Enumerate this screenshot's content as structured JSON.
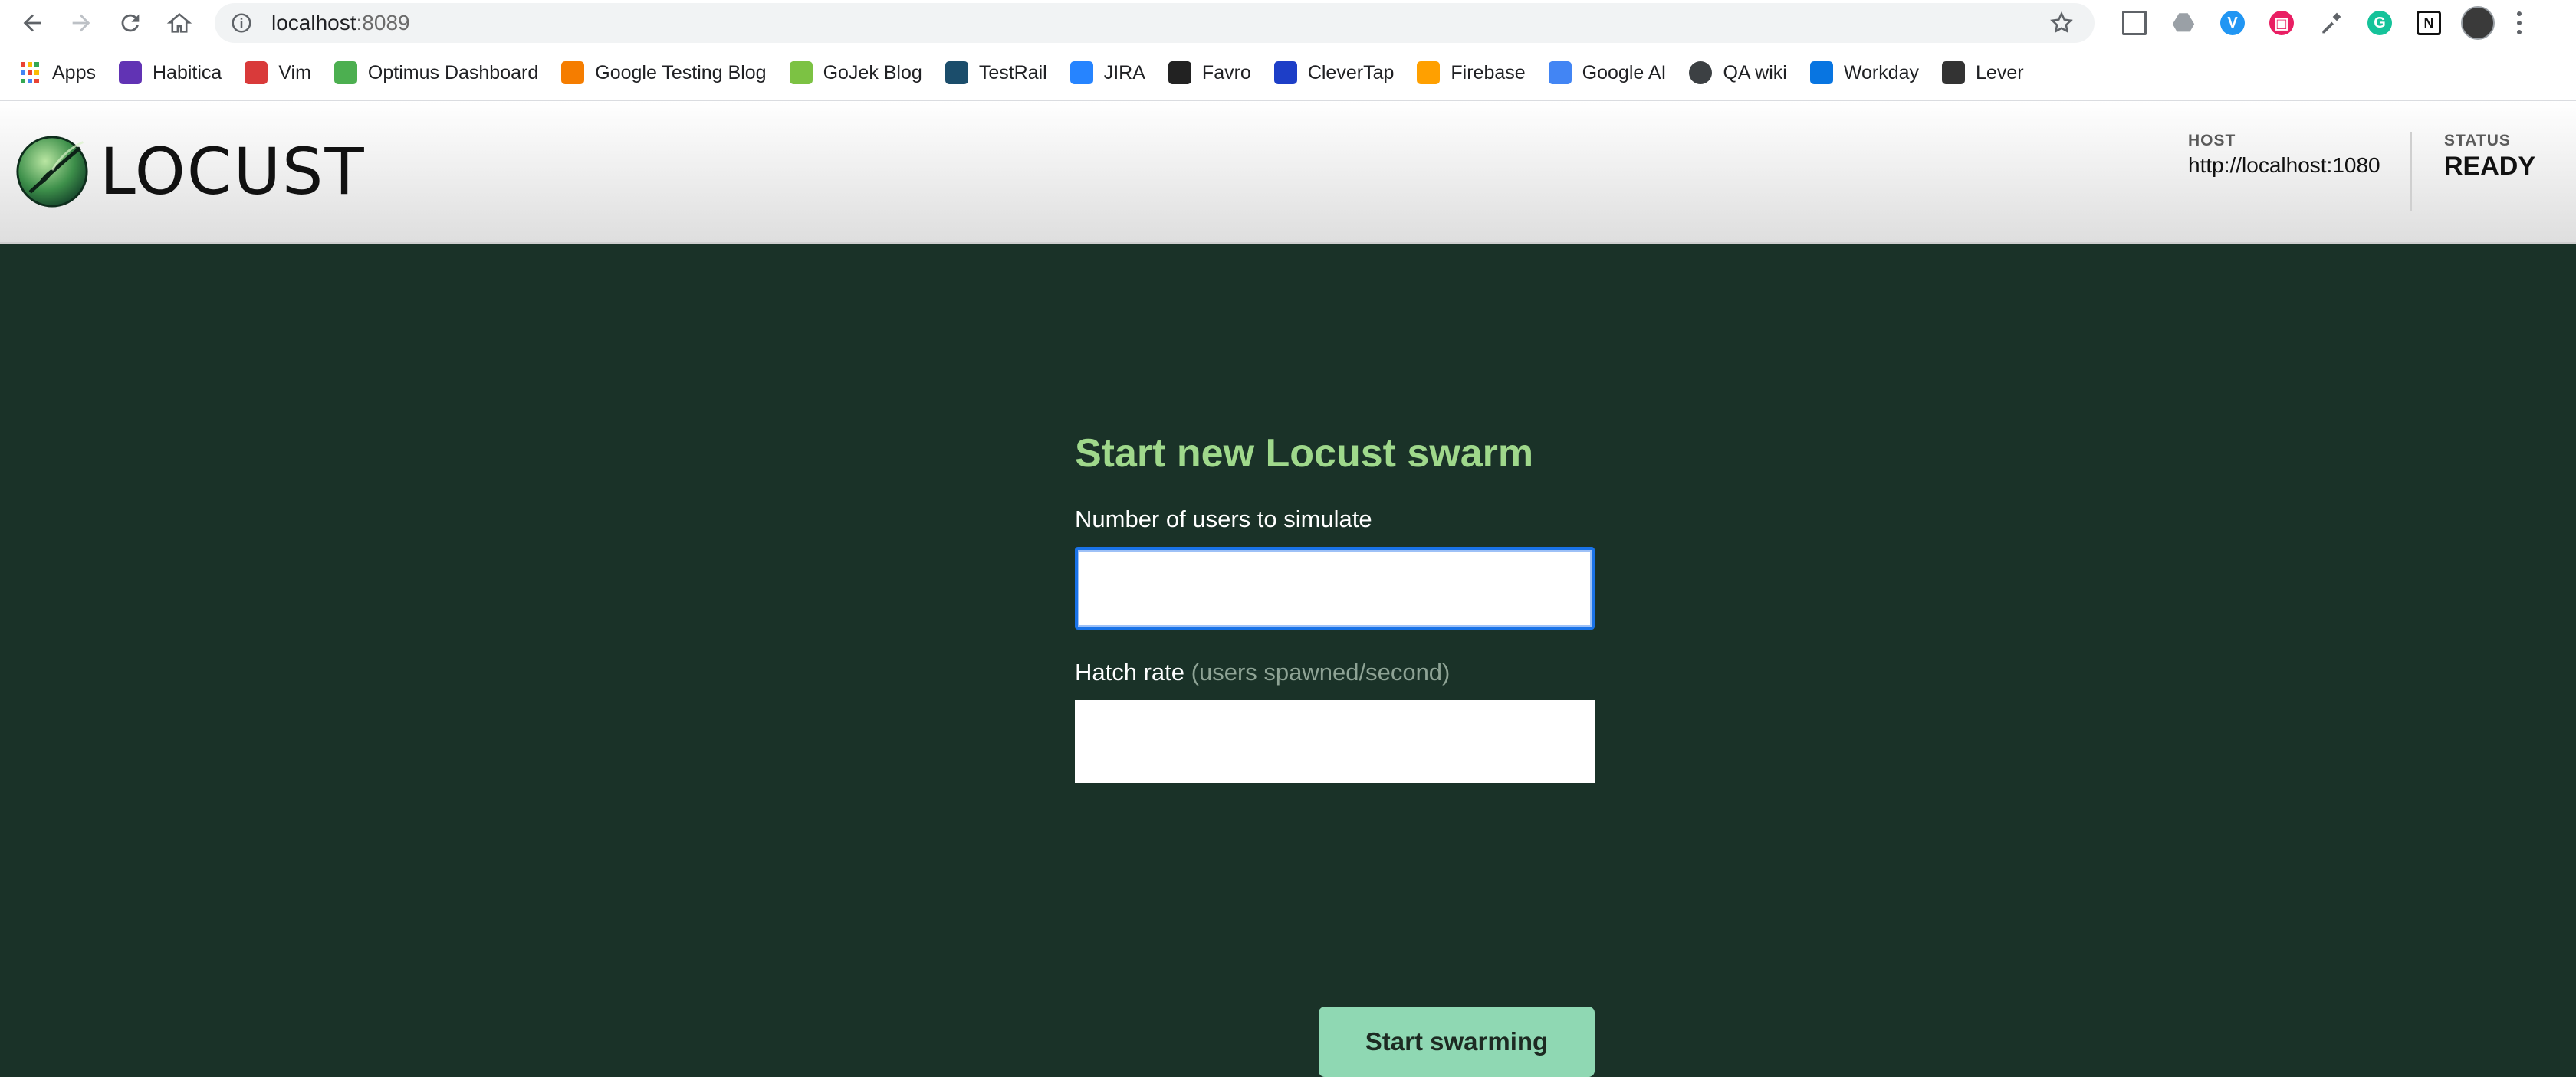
{
  "browser": {
    "url_host": "localhost",
    "url_port": ":8089",
    "bookmarks": [
      {
        "label": "Apps",
        "icon": "apps-grid-icon",
        "color": "#ffffff"
      },
      {
        "label": "Habitica",
        "icon": "habitica-icon",
        "color": "#6133b4"
      },
      {
        "label": "Vim",
        "icon": "vim-icon",
        "color": "#d93a3a"
      },
      {
        "label": "Optimus Dashboard",
        "icon": "optimus-icon",
        "color": "#4caf50"
      },
      {
        "label": "Google Testing Blog",
        "icon": "blogger-icon",
        "color": "#f57d00"
      },
      {
        "label": "GoJek Blog",
        "icon": "gojek-icon",
        "color": "#7cc243"
      },
      {
        "label": "TestRail",
        "icon": "testrail-icon",
        "color": "#1b4d6b"
      },
      {
        "label": "JIRA",
        "icon": "jira-icon",
        "color": "#2684ff"
      },
      {
        "label": "Favro",
        "icon": "favro-icon",
        "color": "#222222"
      },
      {
        "label": "CleverTap",
        "icon": "clevertap-icon",
        "color": "#1d3ec7"
      },
      {
        "label": "Firebase",
        "icon": "firebase-icon",
        "color": "#ffa000"
      },
      {
        "label": "Google AI",
        "icon": "google-ai-icon",
        "color": "#4285f4"
      },
      {
        "label": "QA wiki",
        "icon": "globe-icon",
        "color": "#3c4043"
      },
      {
        "label": "Workday",
        "icon": "workday-icon",
        "color": "#0875e1"
      },
      {
        "label": "Lever",
        "icon": "lever-icon",
        "color": "#333333"
      }
    ]
  },
  "header": {
    "logo_text": "LOCUST",
    "host_label": "HOST",
    "host_value": "http://localhost:1080",
    "status_label": "STATUS",
    "status_value": "READY"
  },
  "form": {
    "title": "Start new Locust swarm",
    "users_label": "Number of users to simulate",
    "users_value": "",
    "hatch_label": "Hatch rate",
    "hatch_hint": "(users spawned/second)",
    "hatch_value": "",
    "submit_label": "Start swarming"
  },
  "colors": {
    "panel_bg": "#1a3228",
    "title_green": "#9fd88b",
    "button_bg": "#8fd8b3",
    "focus_blue": "#1a73e8"
  }
}
